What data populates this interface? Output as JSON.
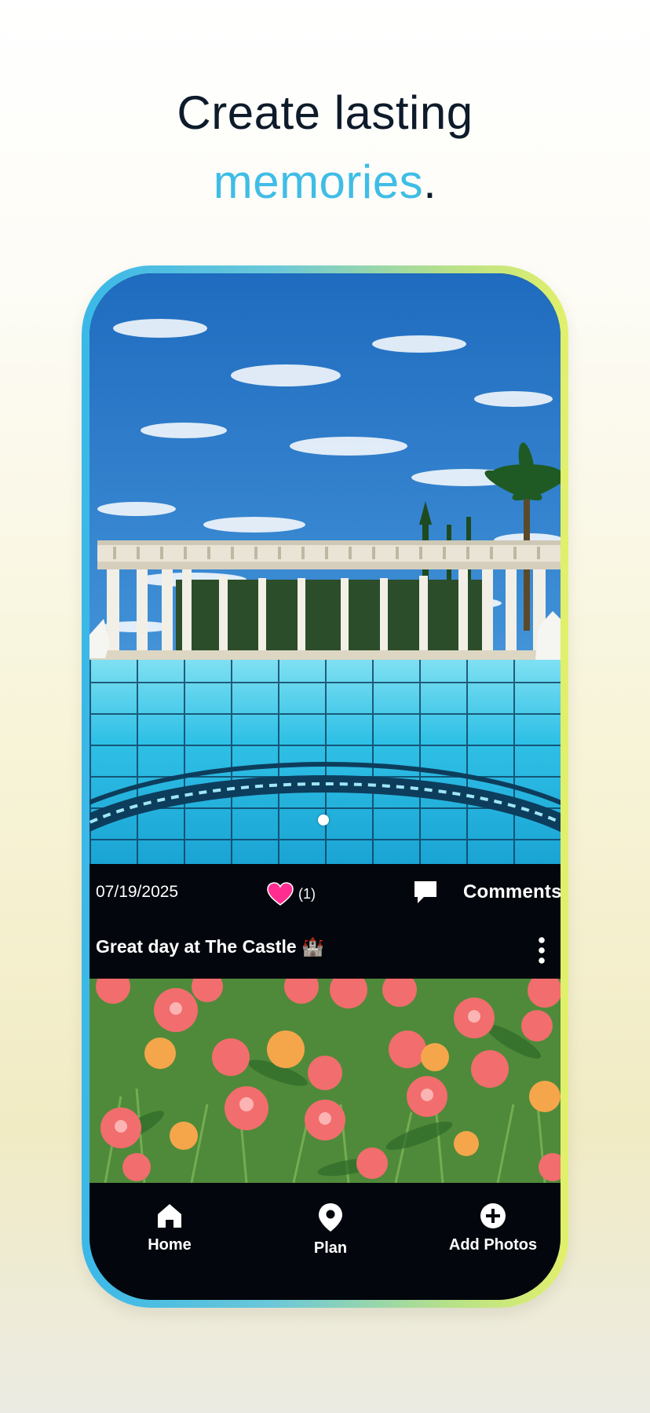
{
  "headline": {
    "line1": "Create lasting",
    "accent_word": "memories",
    "period": "."
  },
  "post": {
    "date": "07/19/2025",
    "like_count": "(1)",
    "comments_label": "Comments",
    "caption": "Great day at The Castle 🏰"
  },
  "nav": {
    "home": "Home",
    "plan": "Plan",
    "add_photos": "Add Photos"
  },
  "icons": {
    "like": "heart-icon",
    "comment": "comment-bubble-icon",
    "more": "more-vertical-icon",
    "home": "home-icon",
    "plan": "map-pin-icon",
    "add": "plus-circle-icon"
  },
  "colors": {
    "accent": "#3fbde6",
    "heading": "#0d1b2a",
    "heart": "#ff2d8f",
    "app_bg": "#03070d"
  }
}
